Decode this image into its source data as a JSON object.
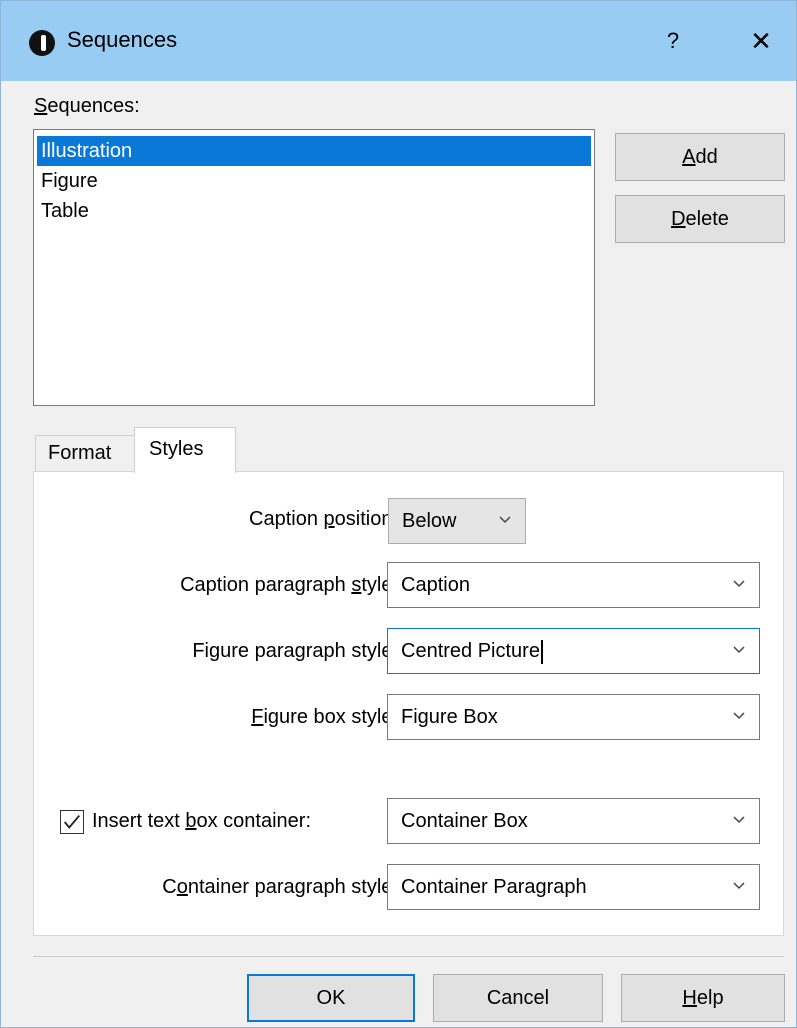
{
  "window": {
    "title": "Sequences",
    "help_glyph": "?",
    "close_glyph": "✕",
    "icon": "info-circle-icon"
  },
  "sequences": {
    "label_mnemonic": "S",
    "label_rest": "equences:",
    "items": [
      {
        "label": "Illustration",
        "selected": true
      },
      {
        "label": "Figure",
        "selected": false
      },
      {
        "label": "Table",
        "selected": false
      }
    ]
  },
  "buttons": {
    "add": {
      "mnemonic": "A",
      "rest": "dd"
    },
    "delete": {
      "mnemonic": "D",
      "rest": "elete"
    }
  },
  "tabs": [
    {
      "label": "Format",
      "active": false
    },
    {
      "label": "Styles",
      "active": true
    }
  ],
  "styles": {
    "caption_position": {
      "label_pre": "Caption ",
      "mnemonic": "p",
      "label_post": "osition:",
      "value": "Below"
    },
    "caption_paragraph_style": {
      "label_pre": "Caption paragraph ",
      "mnemonic": "s",
      "label_post": "tyle:",
      "value": "Caption"
    },
    "figure_paragraph_style": {
      "label": "Figure paragraph style:",
      "value": "Centred Picture"
    },
    "figure_box_style": {
      "mnemonic": "F",
      "label_post": "igure box style:",
      "value": "Figure Box"
    },
    "insert_text_box_container": {
      "label_pre": "Insert text ",
      "mnemonic": "b",
      "label_post": "ox container:",
      "checked": true,
      "value": "Container Box"
    },
    "container_paragraph_style": {
      "label_pre": "C",
      "mnemonic": "o",
      "label_post": "ntainer paragraph style:",
      "value": "Container Paragraph"
    }
  },
  "footer": {
    "ok": "OK",
    "cancel": "Cancel",
    "help_mnemonic": "H",
    "help_rest": "elp"
  },
  "colors": {
    "titlebar": "#99ccf2",
    "selection": "#0a78d7",
    "dialog_bg": "#f0f0f0"
  }
}
